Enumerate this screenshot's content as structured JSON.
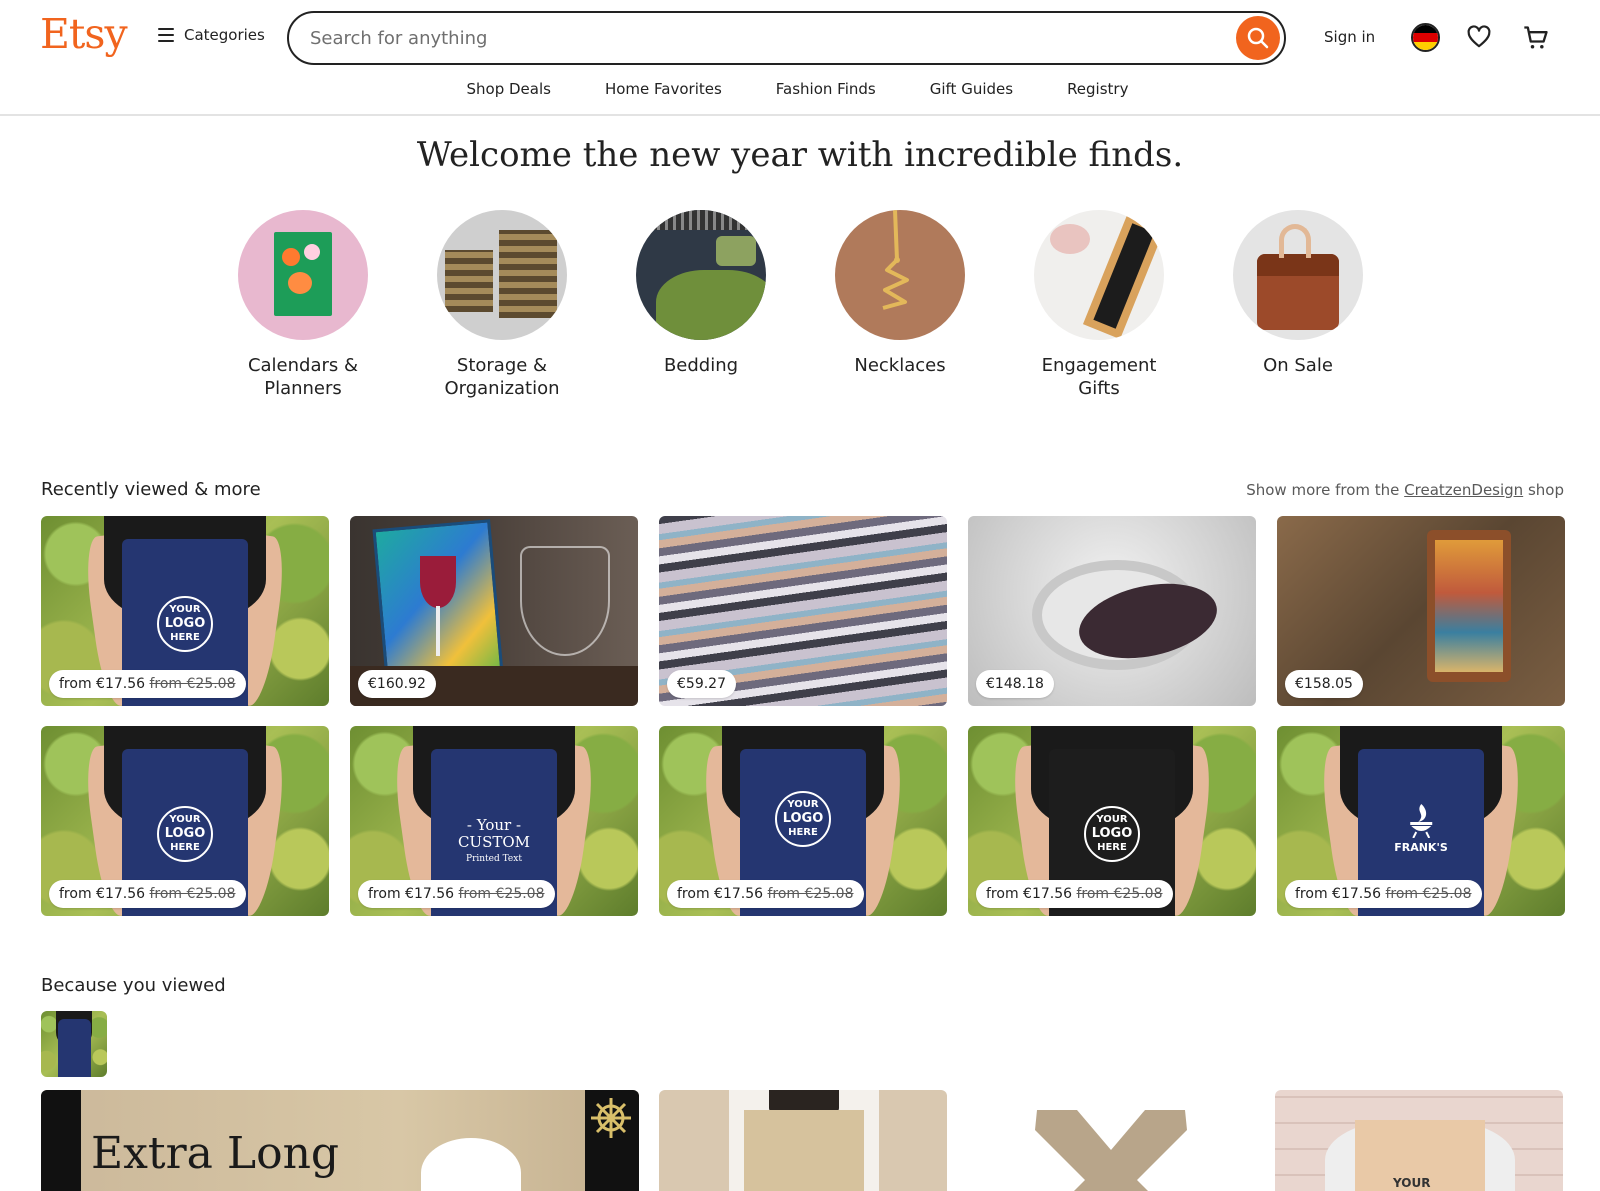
{
  "header": {
    "logo": "Etsy",
    "categories_label": "Categories",
    "search_placeholder": "Search for anything",
    "signin_label": "Sign in",
    "nav": [
      "Shop Deals",
      "Home Favorites",
      "Fashion Finds",
      "Gift Guides",
      "Registry"
    ]
  },
  "welcome": "Welcome the new year with incredible finds.",
  "categories": [
    {
      "label": "Calendars & Planners",
      "icon": "calendar-icon"
    },
    {
      "label": "Storage & Organization",
      "icon": "basket-icon"
    },
    {
      "label": "Bedding",
      "icon": "bed-icon"
    },
    {
      "label": "Necklaces",
      "icon": "necklace-icon"
    },
    {
      "label": "Engagement Gifts",
      "icon": "wine-box-icon"
    },
    {
      "label": "On Sale",
      "icon": "bag-icon"
    }
  ],
  "recent": {
    "title": "Recently viewed & more",
    "show_more_prefix": "Show more from the",
    "shop_name": "CreatzenDesign",
    "show_more_suffix": "shop",
    "row1": [
      {
        "price": "from €17.56",
        "old": "from €25.08",
        "art": "apron"
      },
      {
        "price": "€160.92",
        "old": "",
        "art": "painting"
      },
      {
        "price": "€59.27",
        "old": "",
        "art": "abstract"
      },
      {
        "price": "€148.18",
        "old": "",
        "art": "ring"
      },
      {
        "price": "€158.05",
        "old": "",
        "art": "bag"
      }
    ],
    "row2": [
      {
        "price": "from €17.56",
        "old": "from €25.08",
        "art": "apron-logo"
      },
      {
        "price": "from €17.56",
        "old": "from €25.08",
        "art": "apron-custom"
      },
      {
        "price": "from €17.56",
        "old": "from €25.08",
        "art": "apron-logo"
      },
      {
        "price": "from €17.56",
        "old": "from €25.08",
        "art": "apron-black"
      },
      {
        "price": "from €17.56",
        "old": "from €25.08",
        "art": "apron-franks"
      }
    ],
    "apron_text": {
      "top": "YOUR",
      "mid": "LOGO",
      "bottom": "HERE"
    },
    "custom_text": {
      "top": "- Your -",
      "mid": "CUSTOM",
      "bottom": "Printed Text"
    },
    "franks_text": "FRANK'S"
  },
  "because": {
    "title": "Because you viewed",
    "banner_text": "Extra Long",
    "apron_text": "YOUR"
  },
  "colors": {
    "brand": "#f1641e",
    "apron": "#253671"
  }
}
